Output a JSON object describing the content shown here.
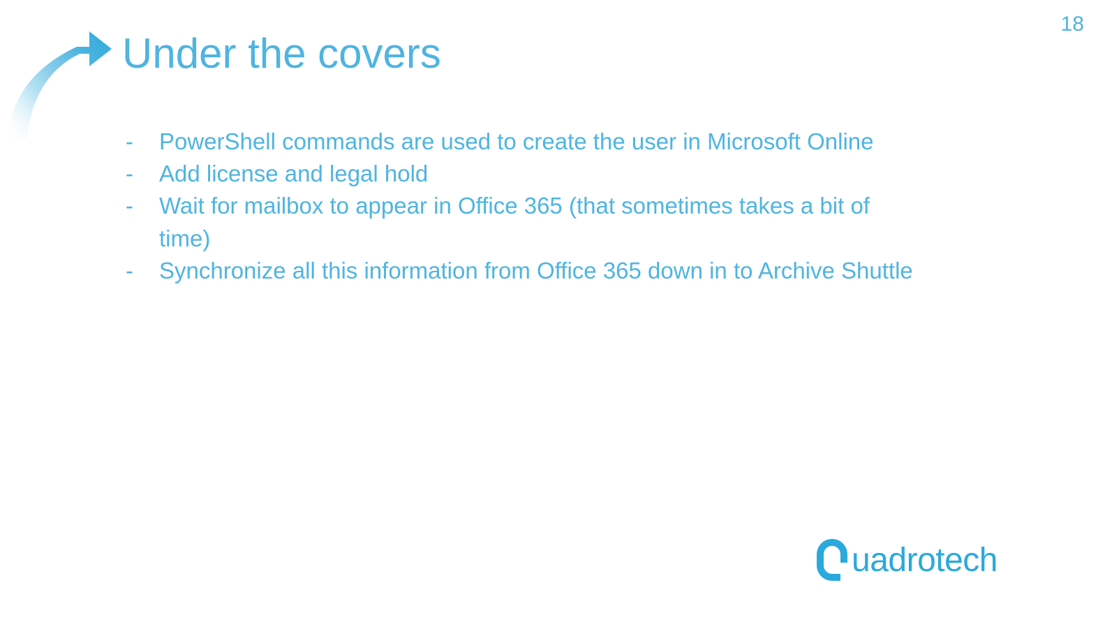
{
  "slide": {
    "page_number": "18",
    "title": "Under the covers",
    "bullets": [
      "PowerShell commands are used to create the user in Microsoft Online",
      "Add license and legal hold",
      "Wait for mailbox to appear in Office 365 (that sometimes takes a bit of time)",
      "Synchronize all this information from Office 365 down in to Archive Shuttle"
    ],
    "logo_text": "Quadrotech"
  },
  "colors": {
    "primary": "#4fb4e0",
    "logo": "#2ba9dc"
  }
}
